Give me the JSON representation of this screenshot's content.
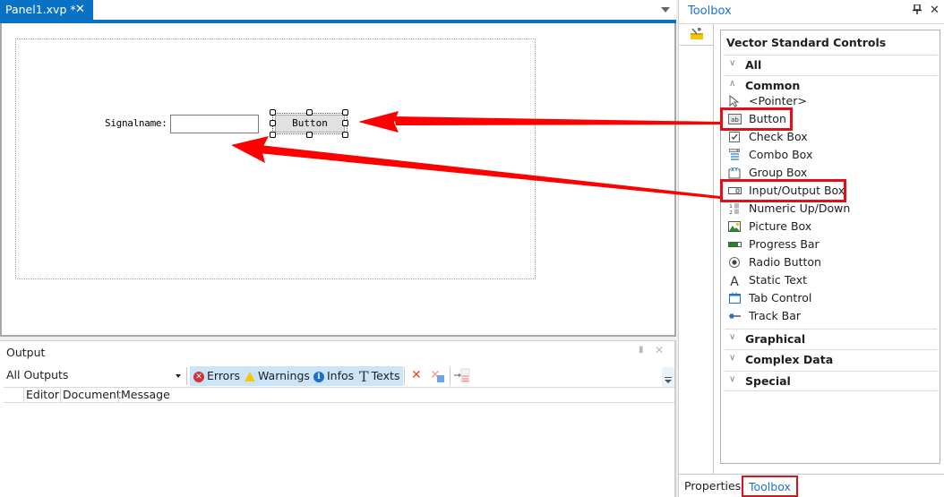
{
  "document": {
    "tab_label": "Panel1.xvp *",
    "tab_close": "✕",
    "signal_label": "Signalname:",
    "signal_input_value": "",
    "button_caption": "Button"
  },
  "output": {
    "title": "Output",
    "pin": "📌",
    "close": "✕",
    "filter_selected": "All Outputs",
    "filters": [
      {
        "label": "Errors",
        "icon": "error-icon"
      },
      {
        "label": "Warnings",
        "icon": "warning-icon"
      },
      {
        "label": "Infos",
        "icon": "info-icon"
      },
      {
        "label": "Texts",
        "icon": "text-icon"
      }
    ],
    "columns": [
      "Editor",
      "Document",
      "Message"
    ]
  },
  "toolbox": {
    "title": "Toolbox",
    "close": "✕",
    "heading": "Vector Standard Controls",
    "categories": {
      "all": "All",
      "common": "Common",
      "graphical": "Graphical",
      "complex": "Complex Data",
      "special": "Special"
    },
    "common_items": [
      "<Pointer>",
      "Button",
      "Check Box",
      "Combo Box",
      "Group Box",
      "Input/Output Box",
      "Numeric Up/Down",
      "Picture Box",
      "Progress Bar",
      "Radio Button",
      "Static Text",
      "Tab Control",
      "Track Bar"
    ],
    "bottom_tabs": [
      "Properties",
      "Toolbox"
    ]
  },
  "annotations": {
    "highlight_color": "#e0101a",
    "highlighted_items": [
      "Button",
      "Input/Output Box",
      "Toolbox"
    ]
  }
}
